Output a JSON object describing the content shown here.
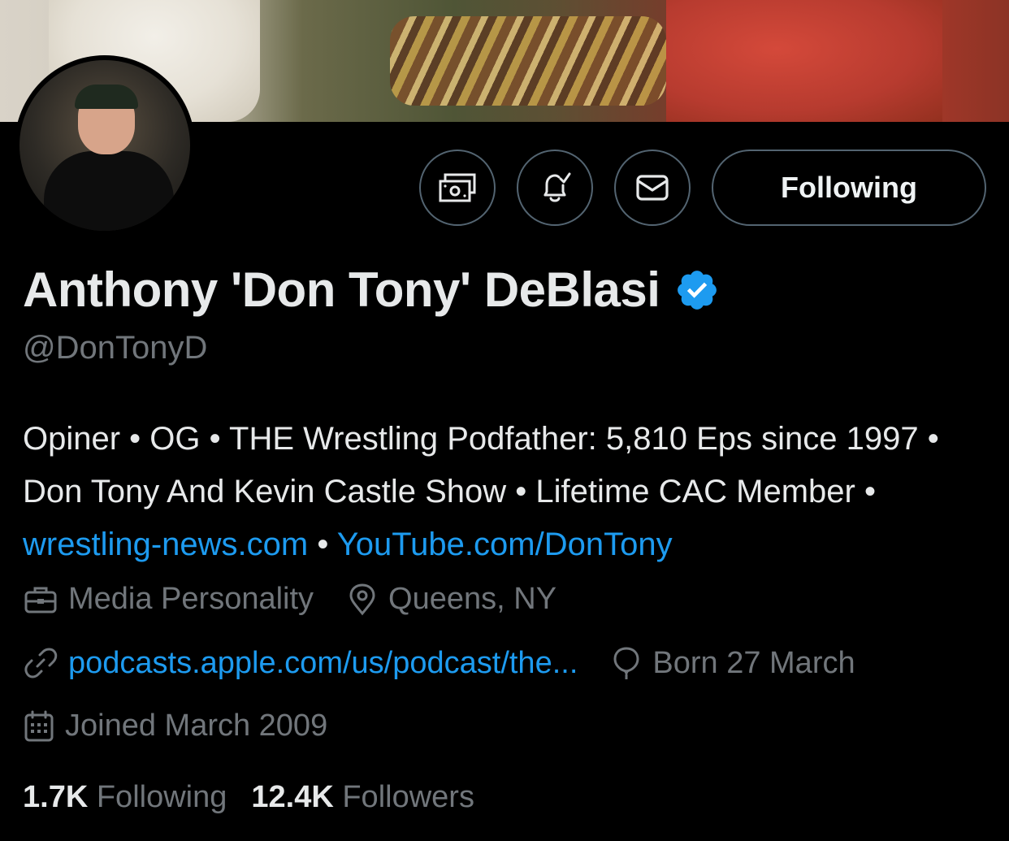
{
  "profile": {
    "name": "Anthony 'Don Tony' DeBlasi",
    "handle": "@DonTonyD",
    "verified": true,
    "bio_segments": [
      {
        "text": "Opiner • OG • THE Wrestling Podfather: 5,810 Eps since 1997 • Don Tony And Kevin Castle Show • Lifetime CAC Member • ",
        "link": false
      },
      {
        "text": "wrestling-news.com",
        "link": true
      },
      {
        "text": " • ",
        "link": false
      },
      {
        "text": "YouTube.com/DonTony",
        "link": true
      }
    ],
    "category": "Media Personality",
    "location": "Queens, NY",
    "website": "podcasts.apple.com/us/podcast/the...",
    "birthday": "Born 27 March",
    "joined": "Joined March 2009"
  },
  "stats": {
    "following_count": "1.7K",
    "following_label": "Following",
    "followers_count": "12.4K",
    "followers_label": "Followers"
  },
  "actions": {
    "follow_label": "Following"
  },
  "colors": {
    "background": "#000000",
    "text_primary": "#e7e9ea",
    "text_secondary": "#71767b",
    "link": "#1d9bf0",
    "border": "#536471",
    "verified_badge": "#1d9bf0"
  }
}
